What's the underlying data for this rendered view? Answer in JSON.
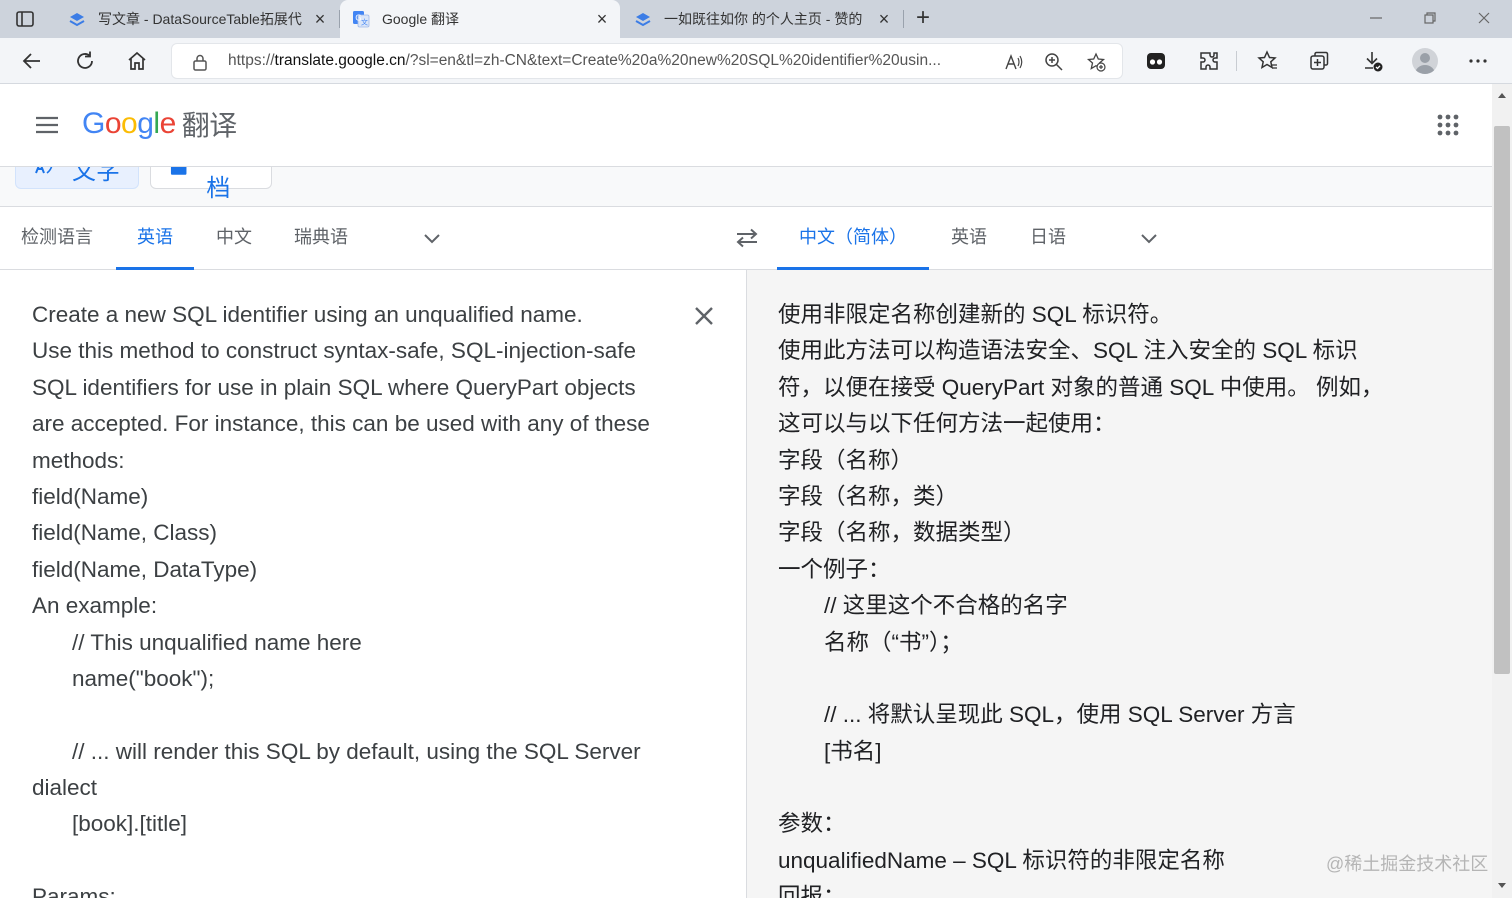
{
  "browser": {
    "tabs": [
      {
        "title": "写文章 - DataSourceTable拓展代",
        "icon": "edge-blue-chevrons-icon",
        "active": false
      },
      {
        "title": "Google 翻译",
        "icon": "google-translate-icon",
        "active": true
      },
      {
        "title": "一如既往如你 的个人主页 - 赞的",
        "icon": "edge-blue-chevrons-icon",
        "active": false
      }
    ],
    "close_glyph": "×",
    "new_tab_glyph": "+",
    "url_prefix": "https://",
    "url_host": "translate.google.cn",
    "url_rest": "/?sl=en&tl=zh-CN&text=Create%20a%20new%20SQL%20identifier%20usin..."
  },
  "header": {
    "logo_letters": [
      "G",
      "o",
      "o",
      "g",
      "l",
      "e"
    ],
    "product": "翻译"
  },
  "modes": {
    "text_label": "文字",
    "doc_label": "文档"
  },
  "source_langs": [
    "检测语言",
    "英语",
    "中文",
    "瑞典语"
  ],
  "target_langs": [
    "中文（简体）",
    "英语",
    "日语"
  ],
  "source_lines": [
    {
      "t": "Create a new SQL identifier using an unqualified name.",
      "indent": false
    },
    {
      "t": "Use this method to construct syntax-safe, SQL-injection-safe",
      "indent": false
    },
    {
      "t": "SQL identifiers for use in plain SQL where QueryPart objects",
      "indent": false
    },
    {
      "t": "are accepted. For instance, this can be used with any of these",
      "indent": false
    },
    {
      "t": "methods:",
      "indent": false
    },
    {
      "t": "field(Name)",
      "indent": false
    },
    {
      "t": "field(Name, Class)",
      "indent": false
    },
    {
      "t": "field(Name, DataType)",
      "indent": false
    },
    {
      "t": "An example:",
      "indent": false
    },
    {
      "t": "// This unqualified name here",
      "indent": true
    },
    {
      "t": "name(\"book\");",
      "indent": true
    },
    {
      "t": "",
      "indent": false
    },
    {
      "t": "// ... will render this SQL by default, using the SQL Server",
      "indent": true
    },
    {
      "t": "dialect",
      "indent": false
    },
    {
      "t": "[book].[title]",
      "indent": true
    },
    {
      "t": "",
      "indent": false
    },
    {
      "t": "Params:",
      "indent": false
    }
  ],
  "target_lines": [
    {
      "t": "使用非限定名称创建新的 SQL 标识符。",
      "indent": false
    },
    {
      "t": "使用此方法可以构造语法安全、SQL 注入安全的 SQL 标识",
      "indent": false
    },
    {
      "t": "符，以便在接受 QueryPart 对象的普通 SQL 中使用。 例如，",
      "indent": false
    },
    {
      "t": "这可以与以下任何方法一起使用：",
      "indent": false
    },
    {
      "t": "字段（名称）",
      "indent": false
    },
    {
      "t": "字段（名称，类）",
      "indent": false
    },
    {
      "t": "字段（名称，数据类型）",
      "indent": false
    },
    {
      "t": "一个例子：",
      "indent": false
    },
    {
      "t": "// 这里这个不合格的名字",
      "indent": true
    },
    {
      "t": "名称（“书”）；",
      "indent": true
    },
    {
      "t": "",
      "indent": false
    },
    {
      "t": "// ... 将默认呈现此 SQL，使用 SQL Server 方言",
      "indent": true
    },
    {
      "t": "[书名]",
      "indent": true
    },
    {
      "t": "",
      "indent": false
    },
    {
      "t": "参数：",
      "indent": false
    },
    {
      "t": "unqualifiedName – SQL 标识符的非限定名称",
      "indent": false
    },
    {
      "t": "回报：",
      "indent": false
    }
  ],
  "watermark": "@稀土掘金技术社区",
  "colors": {
    "google_blue": "#4285f4",
    "google_red": "#ea4335",
    "google_yellow": "#fbbc05",
    "google_green": "#34a853",
    "accent": "#1a73e8"
  }
}
